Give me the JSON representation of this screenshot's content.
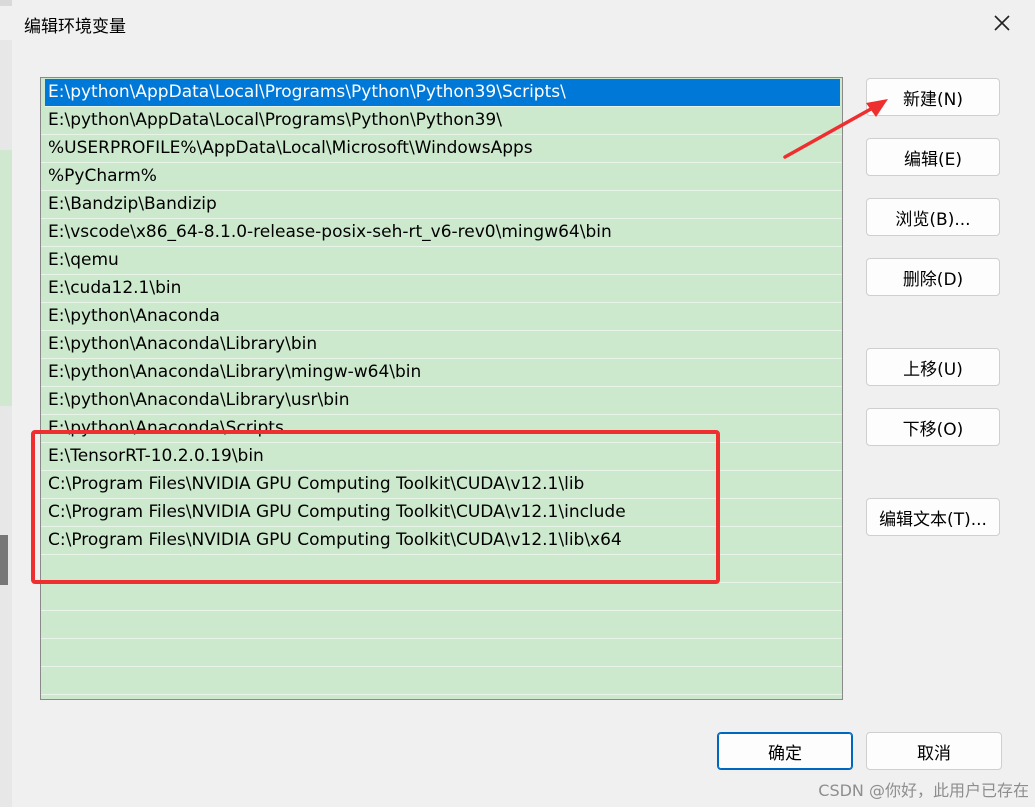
{
  "window": {
    "title": "编辑环境变量",
    "close_icon": "close-icon"
  },
  "paths": [
    "E:\\python\\AppData\\Local\\Programs\\Python\\Python39\\Scripts\\",
    "E:\\python\\AppData\\Local\\Programs\\Python\\Python39\\",
    "%USERPROFILE%\\AppData\\Local\\Microsoft\\WindowsApps",
    "%PyCharm%",
    "E:\\Bandzip\\Bandizip",
    "E:\\vscode\\x86_64-8.1.0-release-posix-seh-rt_v6-rev0\\mingw64\\bin",
    "E:\\qemu",
    "E:\\cuda12.1\\bin",
    "E:\\python\\Anaconda",
    "E:\\python\\Anaconda\\Library\\bin",
    "E:\\python\\Anaconda\\Library\\mingw-w64\\bin",
    "E:\\python\\Anaconda\\Library\\usr\\bin",
    "E:\\python\\Anaconda\\Scripts",
    "E:\\TensorRT-10.2.0.19\\bin",
    "C:\\Program Files\\NVIDIA GPU Computing Toolkit\\CUDA\\v12.1\\lib",
    "C:\\Program Files\\NVIDIA GPU Computing Toolkit\\CUDA\\v12.1\\include",
    "C:\\Program Files\\NVIDIA GPU Computing Toolkit\\CUDA\\v12.1\\lib\\x64"
  ],
  "selected_index": 0,
  "buttons": {
    "new": "新建(N)",
    "edit": "编辑(E)",
    "browse": "浏览(B)...",
    "delete": "删除(D)",
    "move_up": "上移(U)",
    "move_down": "下移(O)",
    "edit_text": "编辑文本(T)...",
    "ok": "确定",
    "cancel": "取消"
  },
  "annotation_color": "#ef2f2f",
  "selection_color": "#0078d7",
  "list_background": "#cde9cd",
  "watermark": "CSDN @你好，此用户已存在"
}
